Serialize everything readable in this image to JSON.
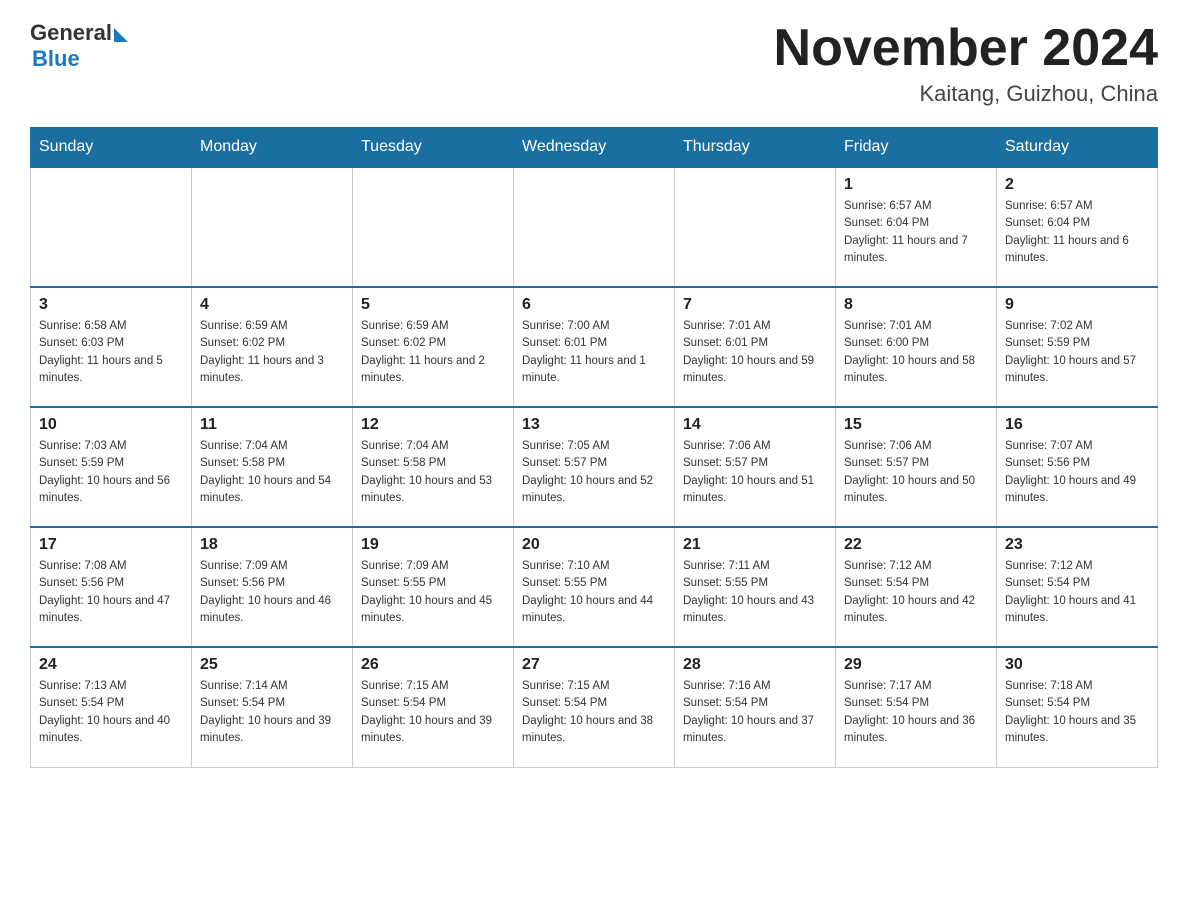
{
  "header": {
    "logo_general": "General",
    "logo_blue": "Blue",
    "month_title": "November 2024",
    "location": "Kaitang, Guizhou, China"
  },
  "days_of_week": [
    "Sunday",
    "Monday",
    "Tuesday",
    "Wednesday",
    "Thursday",
    "Friday",
    "Saturday"
  ],
  "weeks": [
    [
      {
        "day": "",
        "sunrise": "",
        "sunset": "",
        "daylight": ""
      },
      {
        "day": "",
        "sunrise": "",
        "sunset": "",
        "daylight": ""
      },
      {
        "day": "",
        "sunrise": "",
        "sunset": "",
        "daylight": ""
      },
      {
        "day": "",
        "sunrise": "",
        "sunset": "",
        "daylight": ""
      },
      {
        "day": "",
        "sunrise": "",
        "sunset": "",
        "daylight": ""
      },
      {
        "day": "1",
        "sunrise": "Sunrise: 6:57 AM",
        "sunset": "Sunset: 6:04 PM",
        "daylight": "Daylight: 11 hours and 7 minutes."
      },
      {
        "day": "2",
        "sunrise": "Sunrise: 6:57 AM",
        "sunset": "Sunset: 6:04 PM",
        "daylight": "Daylight: 11 hours and 6 minutes."
      }
    ],
    [
      {
        "day": "3",
        "sunrise": "Sunrise: 6:58 AM",
        "sunset": "Sunset: 6:03 PM",
        "daylight": "Daylight: 11 hours and 5 minutes."
      },
      {
        "day": "4",
        "sunrise": "Sunrise: 6:59 AM",
        "sunset": "Sunset: 6:02 PM",
        "daylight": "Daylight: 11 hours and 3 minutes."
      },
      {
        "day": "5",
        "sunrise": "Sunrise: 6:59 AM",
        "sunset": "Sunset: 6:02 PM",
        "daylight": "Daylight: 11 hours and 2 minutes."
      },
      {
        "day": "6",
        "sunrise": "Sunrise: 7:00 AM",
        "sunset": "Sunset: 6:01 PM",
        "daylight": "Daylight: 11 hours and 1 minute."
      },
      {
        "day": "7",
        "sunrise": "Sunrise: 7:01 AM",
        "sunset": "Sunset: 6:01 PM",
        "daylight": "Daylight: 10 hours and 59 minutes."
      },
      {
        "day": "8",
        "sunrise": "Sunrise: 7:01 AM",
        "sunset": "Sunset: 6:00 PM",
        "daylight": "Daylight: 10 hours and 58 minutes."
      },
      {
        "day": "9",
        "sunrise": "Sunrise: 7:02 AM",
        "sunset": "Sunset: 5:59 PM",
        "daylight": "Daylight: 10 hours and 57 minutes."
      }
    ],
    [
      {
        "day": "10",
        "sunrise": "Sunrise: 7:03 AM",
        "sunset": "Sunset: 5:59 PM",
        "daylight": "Daylight: 10 hours and 56 minutes."
      },
      {
        "day": "11",
        "sunrise": "Sunrise: 7:04 AM",
        "sunset": "Sunset: 5:58 PM",
        "daylight": "Daylight: 10 hours and 54 minutes."
      },
      {
        "day": "12",
        "sunrise": "Sunrise: 7:04 AM",
        "sunset": "Sunset: 5:58 PM",
        "daylight": "Daylight: 10 hours and 53 minutes."
      },
      {
        "day": "13",
        "sunrise": "Sunrise: 7:05 AM",
        "sunset": "Sunset: 5:57 PM",
        "daylight": "Daylight: 10 hours and 52 minutes."
      },
      {
        "day": "14",
        "sunrise": "Sunrise: 7:06 AM",
        "sunset": "Sunset: 5:57 PM",
        "daylight": "Daylight: 10 hours and 51 minutes."
      },
      {
        "day": "15",
        "sunrise": "Sunrise: 7:06 AM",
        "sunset": "Sunset: 5:57 PM",
        "daylight": "Daylight: 10 hours and 50 minutes."
      },
      {
        "day": "16",
        "sunrise": "Sunrise: 7:07 AM",
        "sunset": "Sunset: 5:56 PM",
        "daylight": "Daylight: 10 hours and 49 minutes."
      }
    ],
    [
      {
        "day": "17",
        "sunrise": "Sunrise: 7:08 AM",
        "sunset": "Sunset: 5:56 PM",
        "daylight": "Daylight: 10 hours and 47 minutes."
      },
      {
        "day": "18",
        "sunrise": "Sunrise: 7:09 AM",
        "sunset": "Sunset: 5:56 PM",
        "daylight": "Daylight: 10 hours and 46 minutes."
      },
      {
        "day": "19",
        "sunrise": "Sunrise: 7:09 AM",
        "sunset": "Sunset: 5:55 PM",
        "daylight": "Daylight: 10 hours and 45 minutes."
      },
      {
        "day": "20",
        "sunrise": "Sunrise: 7:10 AM",
        "sunset": "Sunset: 5:55 PM",
        "daylight": "Daylight: 10 hours and 44 minutes."
      },
      {
        "day": "21",
        "sunrise": "Sunrise: 7:11 AM",
        "sunset": "Sunset: 5:55 PM",
        "daylight": "Daylight: 10 hours and 43 minutes."
      },
      {
        "day": "22",
        "sunrise": "Sunrise: 7:12 AM",
        "sunset": "Sunset: 5:54 PM",
        "daylight": "Daylight: 10 hours and 42 minutes."
      },
      {
        "day": "23",
        "sunrise": "Sunrise: 7:12 AM",
        "sunset": "Sunset: 5:54 PM",
        "daylight": "Daylight: 10 hours and 41 minutes."
      }
    ],
    [
      {
        "day": "24",
        "sunrise": "Sunrise: 7:13 AM",
        "sunset": "Sunset: 5:54 PM",
        "daylight": "Daylight: 10 hours and 40 minutes."
      },
      {
        "day": "25",
        "sunrise": "Sunrise: 7:14 AM",
        "sunset": "Sunset: 5:54 PM",
        "daylight": "Daylight: 10 hours and 39 minutes."
      },
      {
        "day": "26",
        "sunrise": "Sunrise: 7:15 AM",
        "sunset": "Sunset: 5:54 PM",
        "daylight": "Daylight: 10 hours and 39 minutes."
      },
      {
        "day": "27",
        "sunrise": "Sunrise: 7:15 AM",
        "sunset": "Sunset: 5:54 PM",
        "daylight": "Daylight: 10 hours and 38 minutes."
      },
      {
        "day": "28",
        "sunrise": "Sunrise: 7:16 AM",
        "sunset": "Sunset: 5:54 PM",
        "daylight": "Daylight: 10 hours and 37 minutes."
      },
      {
        "day": "29",
        "sunrise": "Sunrise: 7:17 AM",
        "sunset": "Sunset: 5:54 PM",
        "daylight": "Daylight: 10 hours and 36 minutes."
      },
      {
        "day": "30",
        "sunrise": "Sunrise: 7:18 AM",
        "sunset": "Sunset: 5:54 PM",
        "daylight": "Daylight: 10 hours and 35 minutes."
      }
    ]
  ]
}
